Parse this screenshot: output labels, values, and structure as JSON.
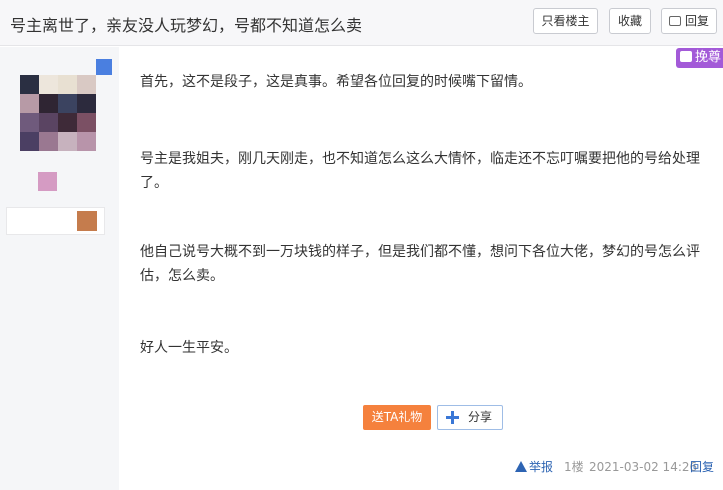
{
  "header": {
    "title": "号主离世了，亲友没人玩梦幻，号都不知道怎么卖",
    "buttons": {
      "only_op": "只看楼主",
      "collect": "收藏",
      "reply": "回复"
    }
  },
  "badges": {
    "vip_label": "挽尊"
  },
  "post": {
    "paragraphs": [
      "首先，这不是段子，这是真事。希望各位回复的时候嘴下留情。",
      "号主是我姐夫，刚几天刚走，也不知道怎么这么大情怀，临走还不忘叮嘱要把他的号给处理了。",
      "他自己说号大概不到一万块钱的样子，但是我们都不懂，想问下各位大佬，梦幻的号怎么评估，怎么卖。",
      "好人一生平安。"
    ],
    "gift_label": "送TA礼物",
    "share_label": "分享"
  },
  "footer": {
    "report": "举报",
    "floor": "1楼",
    "datetime": "2021-03-02 14:26",
    "reply": "回复"
  }
}
